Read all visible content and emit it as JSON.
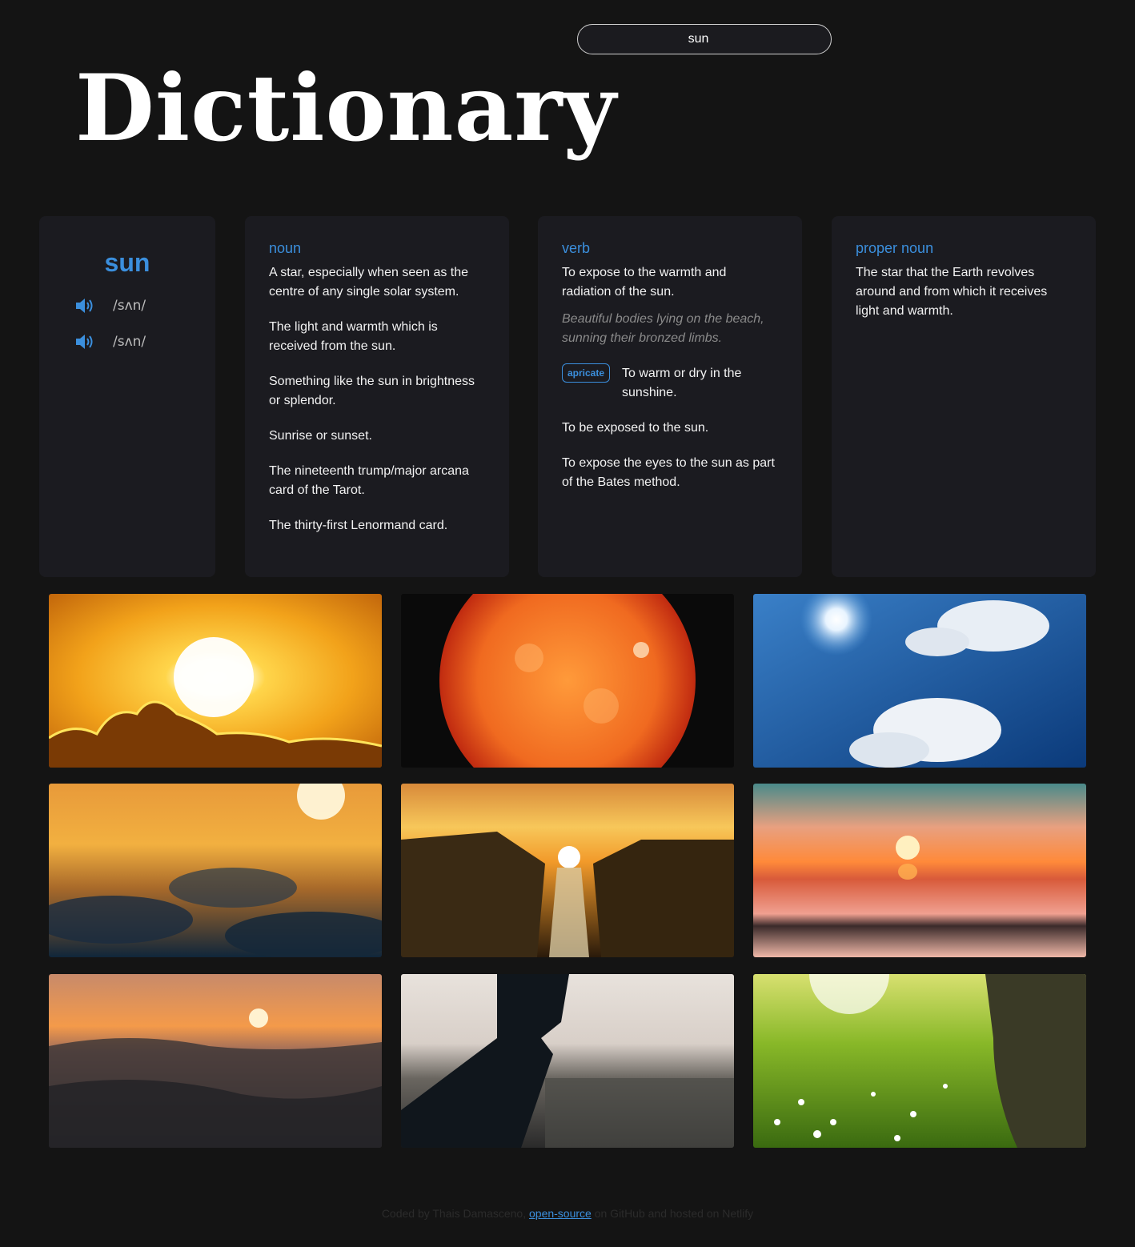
{
  "search": {
    "value": "sun"
  },
  "header": {
    "title": "Dictionary"
  },
  "word_card": {
    "word": "sun",
    "phonetics": [
      {
        "text": "/sʌn/",
        "icon": "speaker-icon"
      },
      {
        "text": "/sʌn/",
        "icon": "speaker-icon"
      }
    ]
  },
  "meanings": {
    "noun": {
      "part_of_speech": "noun",
      "definitions": [
        "A star, especially when seen as the centre of any single solar system.",
        "The light and warmth which is received from the sun.",
        "Something like the sun in brightness or splendor.",
        "Sunrise or sunset.",
        "The nineteenth trump/major arcana card of the Tarot.",
        "The thirty-first Lenormand card."
      ]
    },
    "verb": {
      "part_of_speech": "verb",
      "definitions": [
        "To expose to the warmth and radiation of the sun.",
        "To warm or dry in the sunshine.",
        "To be exposed to the sun.",
        "To expose the eyes to the sun as part of the Bates method."
      ],
      "example": "Beautiful bodies lying on the beach, sunning their bronzed limbs.",
      "synonym": "apricate"
    },
    "proper_noun": {
      "part_of_speech": "proper noun",
      "definitions": [
        "The star that the Earth revolves around and from which it receives light and warmth."
      ]
    }
  },
  "photos": [
    "sunset-clouds-photo",
    "solar-surface-photo",
    "blue-sky-sun-photo",
    "above-clouds-sunset-photo",
    "canyon-sunburst-photo",
    "blurred-sea-sunset-photo",
    "ocean-wave-sunset-photo",
    "hand-city-sunset-photo",
    "meadow-sunlight-photo"
  ],
  "footer": {
    "prefix": "Coded by Thais Damasceno, ",
    "link": "open-source",
    "suffix": " on GitHub and hosted on Netlify"
  },
  "colors": {
    "accent": "#3b8fdd",
    "background": "#141414",
    "card": "#1b1b20"
  }
}
